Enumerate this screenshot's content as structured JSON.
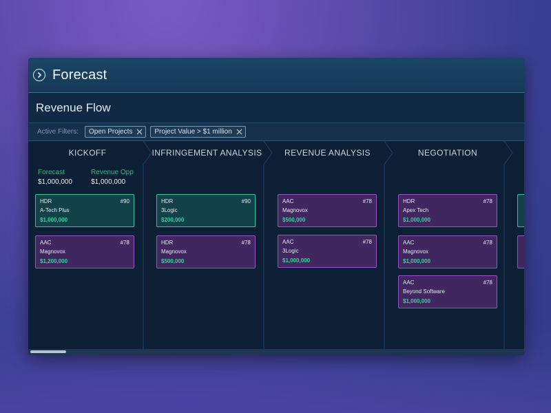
{
  "window": {
    "title": "Forecast"
  },
  "section": {
    "title": "Revenue Flow"
  },
  "filters": {
    "label": "Active Filters:",
    "chips": [
      "Open Projects",
      "Project Value > $1 million"
    ]
  },
  "metrics": {
    "forecast_label": "Forecast",
    "forecast_value": "$1,000,000",
    "revenue_label": "Revenue Opp",
    "revenue_value": "$1,000,000"
  },
  "columns": [
    {
      "title": "KICKOFF",
      "cards": [
        {
          "code": "HDR",
          "number": "#90",
          "company": "A-Tech Plus",
          "amount": "$1,000,000",
          "color": "green"
        },
        {
          "code": "AAC",
          "number": "#78",
          "company": "Magnovox",
          "amount": "$1,200,000",
          "color": "purple"
        }
      ]
    },
    {
      "title": "INFRINGEMENT ANALYSIS",
      "cards": [
        {
          "code": "HDR",
          "number": "#90",
          "company": "3Logic",
          "amount": "$200,000",
          "color": "green"
        },
        {
          "code": "HDR",
          "number": "#78",
          "company": "Magnovox",
          "amount": "$500,000",
          "color": "purple"
        }
      ]
    },
    {
      "title": "REVENUE ANALYSIS",
      "cards": [
        {
          "code": "AAC",
          "number": "#78",
          "company": "Magnovox",
          "amount": "$500,000",
          "color": "purple"
        },
        {
          "code": "AAC",
          "number": "#78",
          "company": "3Logic",
          "amount": "$1,000,000",
          "color": "purple"
        }
      ]
    },
    {
      "title": "NEGOTIATION",
      "cards": [
        {
          "code": "HDR",
          "number": "#78",
          "company": "Apex Tech",
          "amount": "$1,000,000",
          "color": "purple"
        },
        {
          "code": "AAC",
          "number": "#78",
          "company": "Magnovox",
          "amount": "$1,000,000",
          "color": "purple"
        },
        {
          "code": "AAC",
          "number": "#78",
          "company": "Beyond Software",
          "amount": "$1,000,000",
          "color": "purple"
        }
      ]
    }
  ],
  "colors": {
    "green_border": "#2fc79a",
    "purple_border": "#9a52c8",
    "amount": "#35d29a"
  }
}
